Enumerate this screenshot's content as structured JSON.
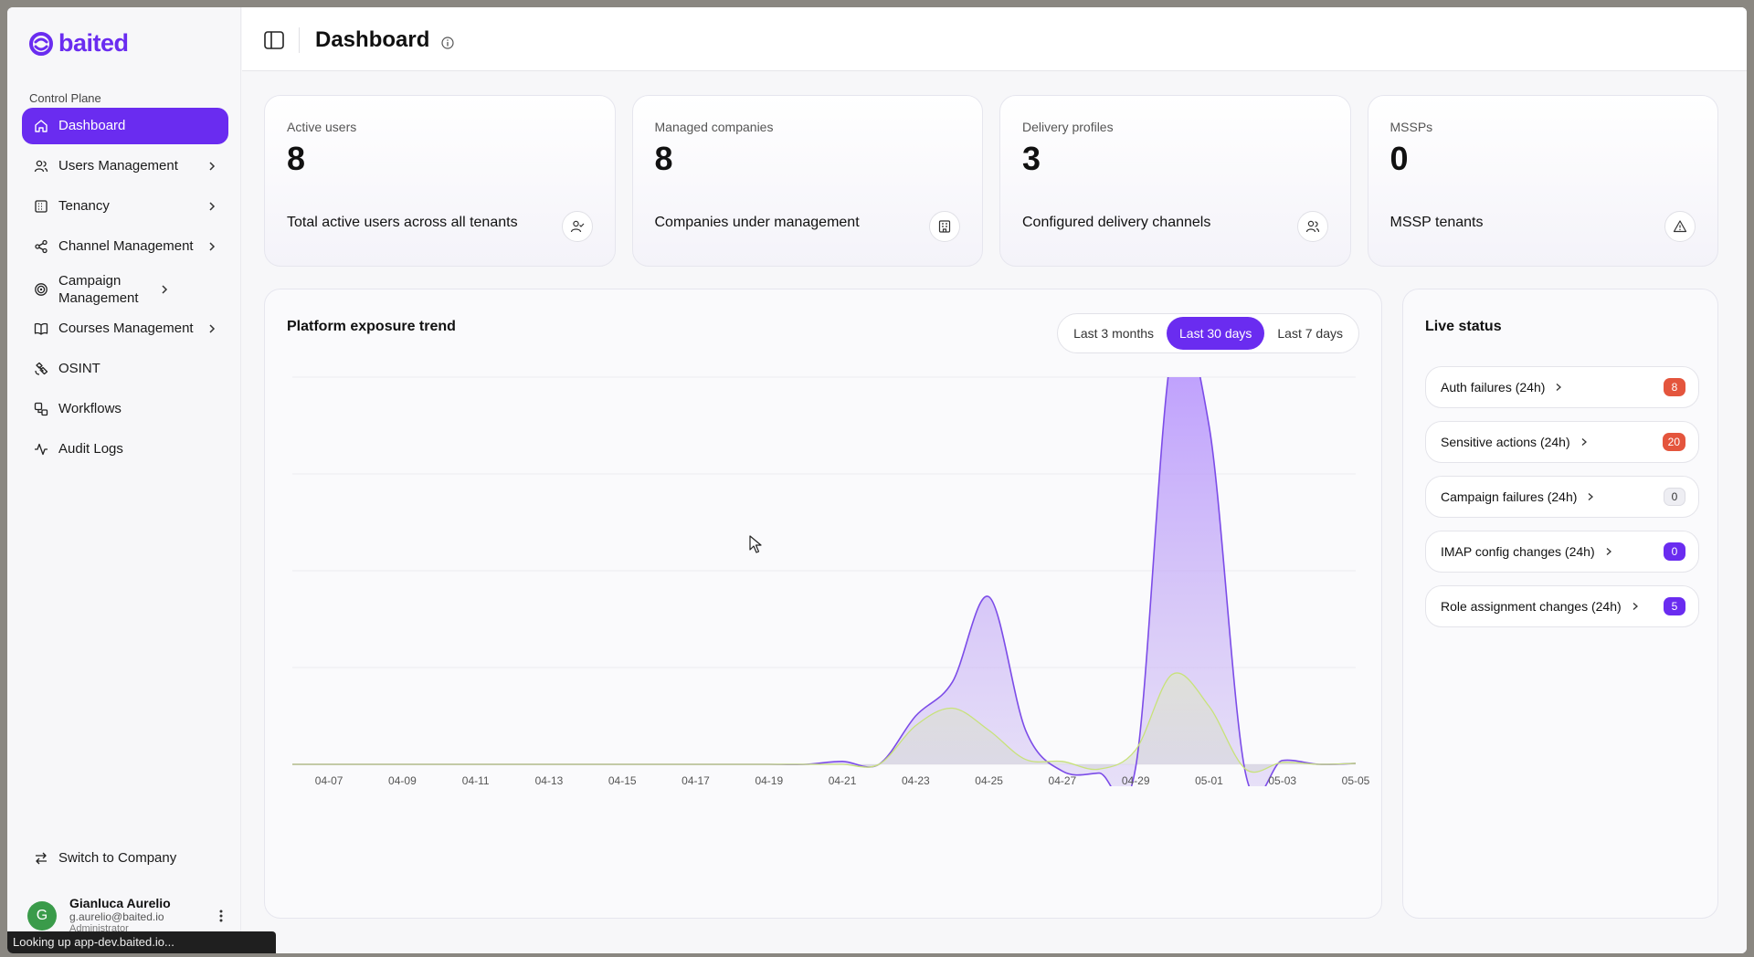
{
  "brand": {
    "name": "baited",
    "accent": "#6a2cf0"
  },
  "sidebar": {
    "section_label": "Control Plane",
    "items": [
      {
        "label": "Dashboard",
        "icon": "home-icon",
        "active": true,
        "has_children": false
      },
      {
        "label": "Users Management",
        "icon": "users-icon",
        "active": false,
        "has_children": true
      },
      {
        "label": "Tenancy",
        "icon": "building-icon",
        "active": false,
        "has_children": true
      },
      {
        "label": "Channel Management",
        "icon": "share-icon",
        "active": false,
        "has_children": true
      },
      {
        "label": "Campaign Management",
        "icon": "target-icon",
        "active": false,
        "has_children": true
      },
      {
        "label": "Courses Management",
        "icon": "book-icon",
        "active": false,
        "has_children": true
      },
      {
        "label": "OSINT",
        "icon": "satellite-icon",
        "active": false,
        "has_children": false
      },
      {
        "label": "Workflows",
        "icon": "workflow-icon",
        "active": false,
        "has_children": false
      },
      {
        "label": "Audit Logs",
        "icon": "activity-icon",
        "active": false,
        "has_children": false
      }
    ],
    "switch_label": "Switch to Company",
    "user": {
      "initial": "G",
      "name": "Gianluca Aurelio",
      "email": "g.aurelio@baited.io",
      "role": "Administrator"
    }
  },
  "status_bar": "Looking up app-dev.baited.io...",
  "header": {
    "title": "Dashboard"
  },
  "stats": [
    {
      "label": "Active users",
      "value": "8",
      "description": "Total active users across all tenants",
      "icon": "user-check-icon"
    },
    {
      "label": "Managed companies",
      "value": "8",
      "description": "Companies under management",
      "icon": "building-icon"
    },
    {
      "label": "Delivery profiles",
      "value": "3",
      "description": "Configured delivery channels",
      "icon": "users-icon"
    },
    {
      "label": "MSSPs",
      "value": "0",
      "description": "MSSP tenants",
      "icon": "warning-icon"
    }
  ],
  "trend": {
    "title": "Platform exposure trend",
    "ranges": [
      "Last 3 months",
      "Last 30 days",
      "Last 7 days"
    ],
    "active_range": "Last 30 days"
  },
  "chart_data": {
    "type": "area",
    "title": "Platform exposure trend",
    "x_ticks": [
      "04-07",
      "04-09",
      "04-11",
      "04-13",
      "04-15",
      "04-17",
      "04-19",
      "04-21",
      "04-23",
      "04-25",
      "04-27",
      "04-29",
      "05-01",
      "05-03",
      "05-05"
    ],
    "x": [
      "04-06",
      "04-07",
      "04-08",
      "04-09",
      "04-10",
      "04-11",
      "04-12",
      "04-13",
      "04-14",
      "04-15",
      "04-16",
      "04-17",
      "04-18",
      "04-19",
      "04-20",
      "04-21",
      "04-22",
      "04-23",
      "04-24",
      "04-25",
      "04-26",
      "04-27",
      "04-28",
      "04-29",
      "04-30",
      "05-01",
      "05-02",
      "05-03",
      "05-04",
      "05-05"
    ],
    "series": [
      {
        "color": "#7c4ce8",
        "values": [
          0,
          0,
          0,
          0,
          0,
          0,
          0,
          0,
          0,
          0,
          0,
          0,
          0,
          0,
          0,
          0.03,
          0,
          0.5,
          0.85,
          1.73,
          0.35,
          -0.07,
          -0.09,
          -0.03,
          4.3,
          3.5,
          -0.1,
          0.04,
          0,
          0.01
        ]
      },
      {
        "color": "#c8e27a",
        "values": [
          0,
          0,
          0,
          0,
          0,
          0,
          0,
          0,
          0,
          0,
          0,
          0,
          0,
          0,
          0,
          0,
          0,
          0.4,
          0.58,
          0.35,
          0.05,
          0.03,
          -0.05,
          0.15,
          0.93,
          0.6,
          -0.05,
          0.02,
          0,
          0.01
        ]
      }
    ],
    "grid": true,
    "legend": "none"
  },
  "live": {
    "title": "Live status",
    "items": [
      {
        "label": "Auth failures (24h)",
        "count": "8",
        "style": "red"
      },
      {
        "label": "Sensitive actions (24h)",
        "count": "20",
        "style": "red"
      },
      {
        "label": "Campaign failures (24h)",
        "count": "0",
        "style": "light"
      },
      {
        "label": "IMAP config changes (24h)",
        "count": "0",
        "style": "purple"
      },
      {
        "label": "Role assignment changes (24h)",
        "count": "5",
        "style": "purple"
      }
    ]
  }
}
